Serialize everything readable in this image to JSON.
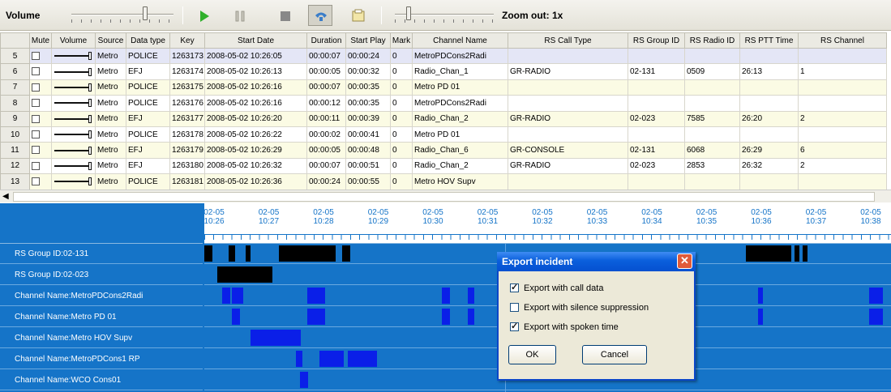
{
  "toolbar": {
    "volume_label": "Volume",
    "zoom_label": "Zoom out: 1x",
    "icons": [
      "play-icon",
      "pause-icon",
      "stop-icon",
      "phone-icon",
      "export-icon"
    ]
  },
  "grid": {
    "columns": [
      "",
      "Mute",
      "Volume",
      "Source",
      "Data type",
      "Key",
      "Start Date",
      "Duration",
      "Start Play",
      "Mark",
      "Channel Name",
      "RS Call Type",
      "RS Group ID",
      "RS Radio ID",
      "RS PTT Time",
      "RS Channel"
    ],
    "rows": [
      {
        "n": "5",
        "source": "Metro",
        "dtype": "POLICE",
        "key": "1263173",
        "start": "2008-05-02 10:26:05",
        "dur": "00:00:07",
        "play": "00:00:24",
        "mark": "0",
        "channel": "MetroPDCons2Radi",
        "call": "",
        "group": "",
        "radio": "",
        "ptt": "",
        "rsch": ""
      },
      {
        "n": "6",
        "source": "Metro",
        "dtype": "EFJ",
        "key": "1263174",
        "start": "2008-05-02 10:26:13",
        "dur": "00:00:05",
        "play": "00:00:32",
        "mark": "0",
        "channel": "Radio_Chan_1",
        "call": "GR-RADIO",
        "group": "02-131",
        "radio": "0509",
        "ptt": "26:13",
        "rsch": "1"
      },
      {
        "n": "7",
        "source": "Metro",
        "dtype": "POLICE",
        "key": "1263175",
        "start": "2008-05-02 10:26:16",
        "dur": "00:00:07",
        "play": "00:00:35",
        "mark": "0",
        "channel": "Metro PD 01",
        "call": "",
        "group": "",
        "radio": "",
        "ptt": "",
        "rsch": ""
      },
      {
        "n": "8",
        "source": "Metro",
        "dtype": "POLICE",
        "key": "1263176",
        "start": "2008-05-02 10:26:16",
        "dur": "00:00:12",
        "play": "00:00:35",
        "mark": "0",
        "channel": "MetroPDCons2Radi",
        "call": "",
        "group": "",
        "radio": "",
        "ptt": "",
        "rsch": ""
      },
      {
        "n": "9",
        "source": "Metro",
        "dtype": "EFJ",
        "key": "1263177",
        "start": "2008-05-02 10:26:20",
        "dur": "00:00:11",
        "play": "00:00:39",
        "mark": "0",
        "channel": "Radio_Chan_2",
        "call": "GR-RADIO",
        "group": "02-023",
        "radio": "7585",
        "ptt": "26:20",
        "rsch": "2"
      },
      {
        "n": "10",
        "source": "Metro",
        "dtype": "POLICE",
        "key": "1263178",
        "start": "2008-05-02 10:26:22",
        "dur": "00:00:02",
        "play": "00:00:41",
        "mark": "0",
        "channel": "Metro PD 01",
        "call": "",
        "group": "",
        "radio": "",
        "ptt": "",
        "rsch": ""
      },
      {
        "n": "11",
        "source": "Metro",
        "dtype": "EFJ",
        "key": "1263179",
        "start": "2008-05-02 10:26:29",
        "dur": "00:00:05",
        "play": "00:00:48",
        "mark": "0",
        "channel": "Radio_Chan_6",
        "call": "GR-CONSOLE",
        "group": "02-131",
        "radio": "6068",
        "ptt": "26:29",
        "rsch": "6"
      },
      {
        "n": "12",
        "source": "Metro",
        "dtype": "EFJ",
        "key": "1263180",
        "start": "2008-05-02 10:26:32",
        "dur": "00:00:07",
        "play": "00:00:51",
        "mark": "0",
        "channel": "Radio_Chan_2",
        "call": "GR-RADIO",
        "group": "02-023",
        "radio": "2853",
        "ptt": "26:32",
        "rsch": "2"
      },
      {
        "n": "13",
        "source": "Metro",
        "dtype": "POLICE",
        "key": "1263181",
        "start": "2008-05-02 10:26:36",
        "dur": "00:00:24",
        "play": "00:00:55",
        "mark": "0",
        "channel": "Metro HOV Supv",
        "call": "",
        "group": "",
        "radio": "",
        "ptt": "",
        "rsch": ""
      }
    ]
  },
  "timeline": {
    "ticks": [
      {
        "d": "02-05",
        "t": "10:26"
      },
      {
        "d": "02-05",
        "t": "10:27"
      },
      {
        "d": "02-05",
        "t": "10:28"
      },
      {
        "d": "02-05",
        "t": "10:29"
      },
      {
        "d": "02-05",
        "t": "10:30"
      },
      {
        "d": "02-05",
        "t": "10:31"
      },
      {
        "d": "02-05",
        "t": "10:32"
      },
      {
        "d": "02-05",
        "t": "10:33"
      },
      {
        "d": "02-05",
        "t": "10:34"
      },
      {
        "d": "02-05",
        "t": "10:35"
      },
      {
        "d": "02-05",
        "t": "10:36"
      },
      {
        "d": "02-05",
        "t": "10:37"
      },
      {
        "d": "02-05",
        "t": "10:38"
      }
    ],
    "tracks": [
      {
        "label": "RS Group ID:02-131",
        "color": "#000000"
      },
      {
        "label": "RS Group ID:02-023",
        "color": "#000000"
      },
      {
        "label": "Channel Name:MetroPDCons2Radi",
        "color": "#0a1fe8"
      },
      {
        "label": "Channel Name:Metro PD 01",
        "color": "#0a1fe8"
      },
      {
        "label": "Channel Name:Metro HOV Supv",
        "color": "#0a1fe8"
      },
      {
        "label": "Channel Name:MetroPDCons1 RP",
        "color": "#0a1fe8"
      },
      {
        "label": "Channel Name:WCO Cons01",
        "color": "#0a1fe8"
      }
    ]
  },
  "dialog": {
    "title": "Export incident",
    "options": [
      {
        "label": "Export with call data",
        "checked": true
      },
      {
        "label": "Export with silence suppression",
        "checked": false
      },
      {
        "label": "Export with spoken time",
        "checked": true
      }
    ],
    "ok_label": "OK",
    "cancel_label": "Cancel"
  }
}
